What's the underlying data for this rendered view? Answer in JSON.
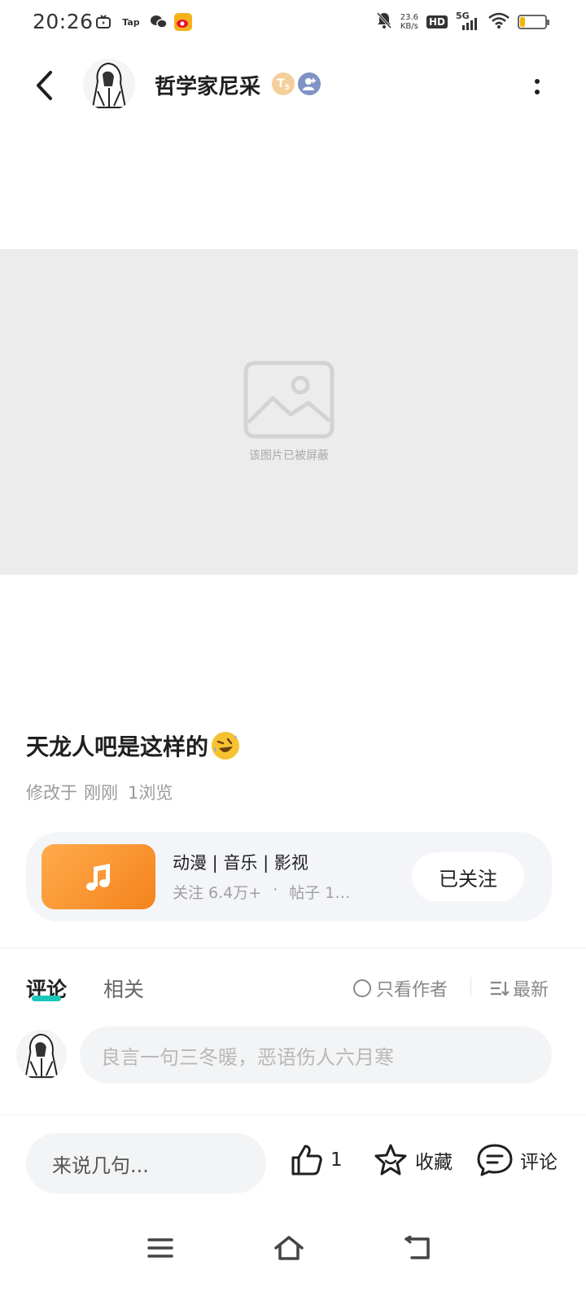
{
  "status_bar": {
    "time": "20:26",
    "app_icons": [
      "tv-icon",
      "tap-icon",
      "wechat-icon",
      "weibo-icon"
    ],
    "tap_label": "Tap",
    "net_speed_value": "23.6",
    "net_speed_unit": "KB/s",
    "hd_label": "HD",
    "network_label": "5G",
    "battery_level": 0.2,
    "battery_color": "#f4b400"
  },
  "header": {
    "user_name": "哲学家尼采",
    "level_badge": "T",
    "level_num": "5"
  },
  "blocked_image": {
    "text": "该图片已被屏蔽"
  },
  "post": {
    "title": "天龙人吧是这样的",
    "meta_prefix": "修改于",
    "meta_time": "刚刚",
    "meta_views": "1浏览"
  },
  "forum": {
    "name": "动漫 | 音乐 | 影视",
    "followers": "关注 6.4万+",
    "dot": "·",
    "posts": "帖子 1…",
    "follow_label": "已关注",
    "thumb_colors": [
      "#ffab4d",
      "#f5831c"
    ]
  },
  "tabs": {
    "comments": "评论",
    "related": "相关",
    "only_author": "只看作者",
    "sort": "最新",
    "accent": "#1bc6ba"
  },
  "comment": {
    "placeholder": "良言一句三冬暖，恶语伤人六月寒"
  },
  "bottom_bar": {
    "say_placeholder": "来说几句...",
    "like_count": "1",
    "fav_label": "收藏",
    "comment_label": "评论"
  }
}
